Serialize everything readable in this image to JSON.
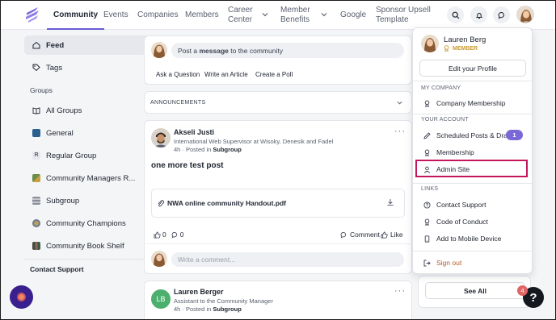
{
  "nav": {
    "items": [
      {
        "label": "Community",
        "active": true
      },
      {
        "label": "Events"
      },
      {
        "label": "Companies"
      },
      {
        "label": "Members"
      },
      {
        "label_l1": "Career",
        "label_l2": "Center"
      },
      {
        "label_l1": "Member",
        "label_l2": "Benefits"
      },
      {
        "label": "Google"
      },
      {
        "label_l1": "Sponsor Upsell",
        "label_l2": "Template"
      }
    ]
  },
  "sidebar": {
    "feed": "Feed",
    "tags": "Tags",
    "groups_heading": "Groups",
    "groups": [
      {
        "label": "All Groups",
        "icon": "book-icon"
      },
      {
        "label": "General",
        "icon_color": "#2b5f8f"
      },
      {
        "label": "Regular Group",
        "letter": "R"
      },
      {
        "label": "Community Managers R...",
        "icon_color": "#6a8f4a"
      },
      {
        "label": "Subgroup",
        "icon_color": "#8a8f99"
      },
      {
        "label": "Community Champions",
        "icon_color": "#8a7a4a"
      },
      {
        "label": "Community Book Shelf",
        "icon_color": "#4a4a4a"
      }
    ],
    "contact_support": "Contact Support"
  },
  "composer": {
    "prompt_pre": "Post a ",
    "prompt_bold": "message",
    "prompt_post": " to the community",
    "ask": "Ask a Question",
    "write": "Write an Article",
    "poll": "Create a Poll"
  },
  "announcements": {
    "label": "ANNOUNCEMENTS"
  },
  "post": {
    "author": "Akseli Justi",
    "author_title": "International Web Supervisor at Wisoky, Denesik and Fadel",
    "time": "4h",
    "posted_in_pre": " · Posted in ",
    "group": "Subgroup",
    "body": "one more test post",
    "attachment": "NWA online community Handout.pdf",
    "likes": "0",
    "comments": "0",
    "comment_label": "Comment",
    "like_label": "Like",
    "comment_placeholder": "Write a comment..."
  },
  "post2": {
    "initials": "LB",
    "author": "Lauren Berger",
    "author_title": "Assistant to the Community Manager",
    "time": "4h",
    "posted_in_pre": " · Posted in ",
    "group": "Subgroup"
  },
  "menu": {
    "user_name": "Lauren Berg",
    "user_role": "MEMBER",
    "edit_profile": "Edit your Profile",
    "my_company": "MY COMPANY",
    "company_membership": "Company Membership",
    "your_account": "YOUR ACCOUNT",
    "scheduled": "Scheduled Posts & Drafts",
    "scheduled_count": "1",
    "membership": "Membership",
    "admin_site": "Admin Site",
    "links": "LINKS",
    "contact_support": "Contact Support",
    "code_of_conduct": "Code of Conduct",
    "add_mobile": "Add to Mobile Device",
    "sign_out": "Sign out"
  },
  "see_all": "See All",
  "help": {
    "badge": "4",
    "glyph": "?"
  },
  "colors": {
    "accent": "#6c5bd4",
    "highlight": "#c2185b",
    "badge": "#7b68d8",
    "role": "#c99a2e"
  }
}
